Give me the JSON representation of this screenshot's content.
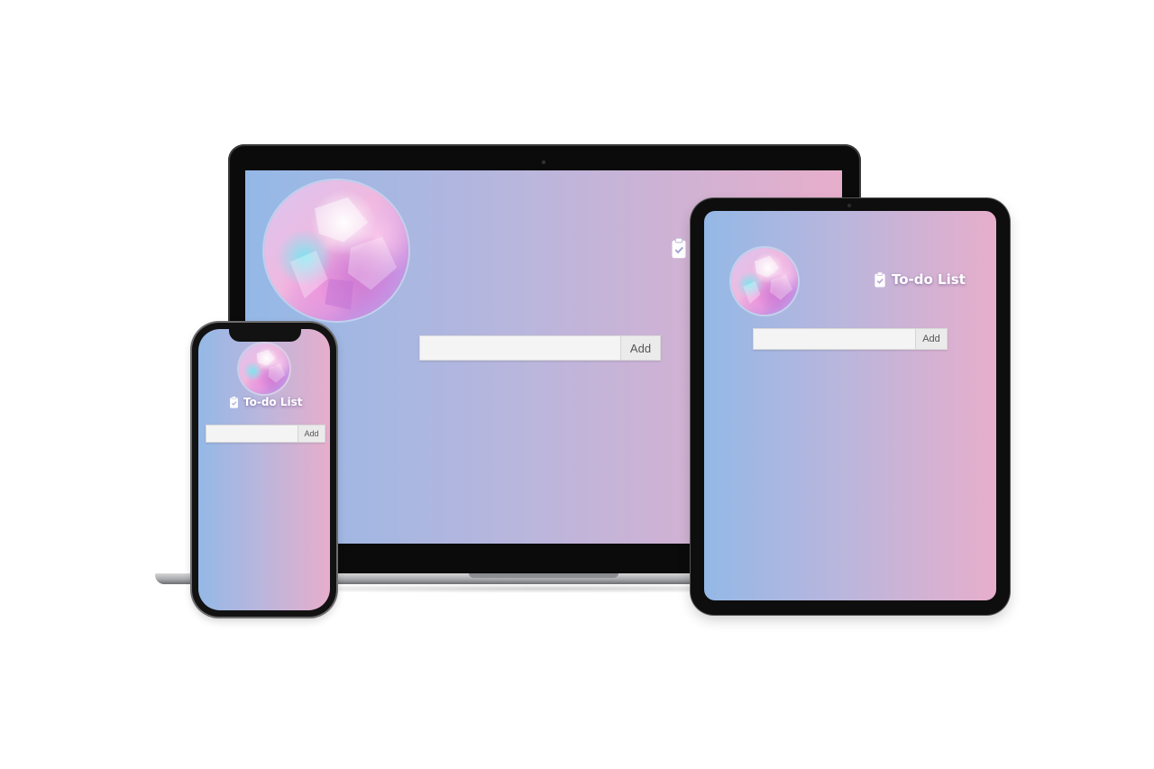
{
  "app": {
    "title": "To-do List",
    "add_label": "Add",
    "input_value": "",
    "input_placeholder": "",
    "header_image": "crystal-cluster-image",
    "icon": "clipboard-check-icon",
    "colors": {
      "gradient_start": "#94b8e6",
      "gradient_mid": "#b8b6dd",
      "gradient_end": "#e7aecb",
      "title_text": "#ffffff",
      "button_bg": "#ebebeb"
    }
  },
  "devices": [
    "laptop",
    "tablet",
    "phone"
  ]
}
